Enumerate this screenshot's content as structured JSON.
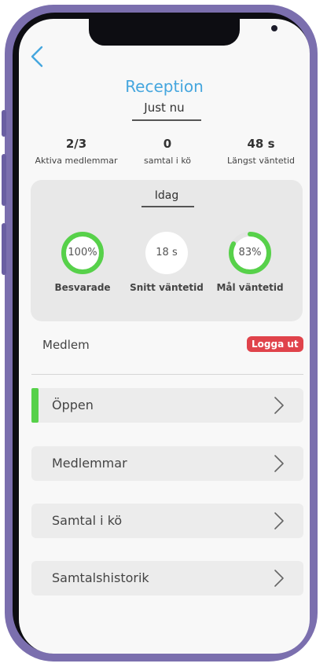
{
  "header": {
    "title": "Reception"
  },
  "current": {
    "heading": "Just nu",
    "stats": [
      {
        "value": "2/3",
        "label": "Aktiva medlemmar"
      },
      {
        "value": "0",
        "label": "samtal i kö"
      },
      {
        "value": "48 s",
        "label": "Längst väntetid"
      }
    ]
  },
  "today": {
    "heading": "Idag",
    "metrics": [
      {
        "value": "100%",
        "fraction": 1.0,
        "label": "Besvarade"
      },
      {
        "value": "18 s",
        "label": "Snitt väntetid"
      },
      {
        "value": "83%",
        "fraction": 0.83,
        "label": "Mål väntetid"
      }
    ]
  },
  "member": {
    "label": "Medlem",
    "logout_label": "Logga ut"
  },
  "nav": [
    {
      "label": "Öppen"
    },
    {
      "label": "Medlemmar"
    },
    {
      "label": "Samtal i kö"
    },
    {
      "label": "Samtalshistorik"
    }
  ],
  "colors": {
    "accent": "#45a6de",
    "success": "#57d14a",
    "danger": "#e0434b",
    "frame": "#7b6fae"
  }
}
